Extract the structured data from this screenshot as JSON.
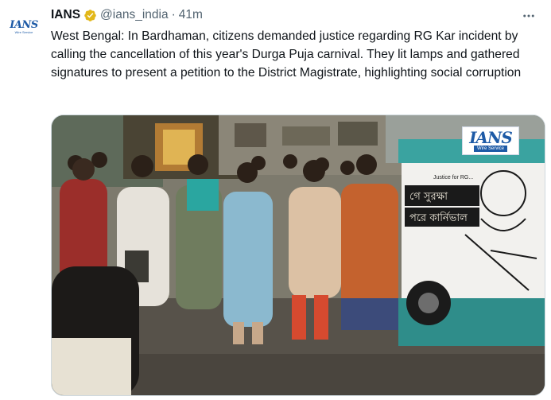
{
  "author": {
    "name": "IANS",
    "handle": "@ians_india",
    "separator": "·",
    "timestamp": "41m",
    "verified_badge_color": "#e2b719",
    "avatar_text": "IANS",
    "avatar_subtext": "Wire Service"
  },
  "tweet": {
    "text": "West Bengal: In Bardhaman, citizens demanded justice regarding RG Kar incident by calling the cancellation of this year's Durga Puja carnival. They lit lamps and gathered signatures to present a petition to the District Magistrate, highlighting social corruption"
  },
  "media": {
    "watermark_logo": "IANS",
    "watermark_sub": "Wire Service",
    "banner_small_text": "Justice for RG...",
    "banner_line1": "গে সুরক্ষা",
    "banner_line2": "পরে কার্নিভাল"
  },
  "icons": {
    "more": "more-horizontal-icon",
    "verified": "verified-badge-icon"
  }
}
